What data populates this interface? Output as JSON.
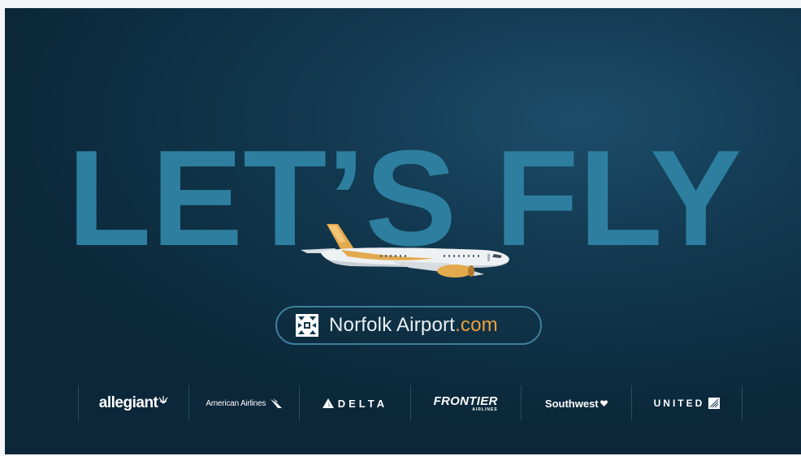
{
  "headline": "LET’S FLY",
  "website": {
    "domain": "Norfolk Airport",
    "tld": ".com"
  },
  "airlines": [
    {
      "name": "allegiant",
      "icon": "allegiant-sunburst-icon"
    },
    {
      "name": "American Airlines",
      "icon": "american-eagle-icon"
    },
    {
      "name": "DELTA",
      "icon": "delta-triangle-icon"
    },
    {
      "name": "FRONTIER",
      "sub": "AIRLINES"
    },
    {
      "name": "Southwest",
      "icon": "southwest-heart-icon"
    },
    {
      "name": "UNITED",
      "icon": "united-globe-icon"
    }
  ],
  "colors": {
    "background": "#12384f",
    "headline": "#2e7f9f",
    "accent": "#e9a03a",
    "pill_border": "#3d7f9b",
    "text_light": "#e9f1f6"
  }
}
